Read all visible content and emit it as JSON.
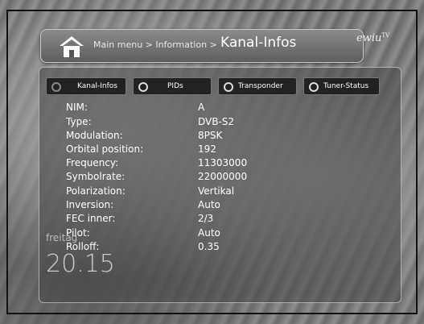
{
  "header": {
    "breadcrumb": "Main menu > Information >",
    "title": "Kanal-Infos",
    "logo": "ewiu",
    "logo_sub": "TV"
  },
  "tabs": [
    {
      "label": "Kanal-Infos",
      "active": false
    },
    {
      "label": "PIDs",
      "active": true
    },
    {
      "label": "Transponder",
      "active": true
    },
    {
      "label": "Tuner-Status",
      "active": true
    }
  ],
  "info": [
    {
      "key": "NIM:",
      "value": "A"
    },
    {
      "key": "Type:",
      "value": "DVB-S2"
    },
    {
      "key": "Modulation:",
      "value": "8PSK"
    },
    {
      "key": "Orbital position:",
      "value": "192"
    },
    {
      "key": "Frequency:",
      "value": "11303000"
    },
    {
      "key": "Symbolrate:",
      "value": "22000000"
    },
    {
      "key": "Polarization:",
      "value": "Vertikal"
    },
    {
      "key": "Inversion:",
      "value": "Auto"
    },
    {
      "key": "FEC inner:",
      "value": "2/3"
    },
    {
      "key": "Pilot:",
      "value": "Auto"
    },
    {
      "key": "Rolloff:",
      "value": "0.35"
    }
  ],
  "clock": {
    "day": "freitag",
    "time": "20.15"
  },
  "colors": {
    "panel_border": "#d2d2d2",
    "tab_bg": "#222222",
    "text": "#ffffff"
  },
  "icons": {
    "home": "home-icon"
  }
}
